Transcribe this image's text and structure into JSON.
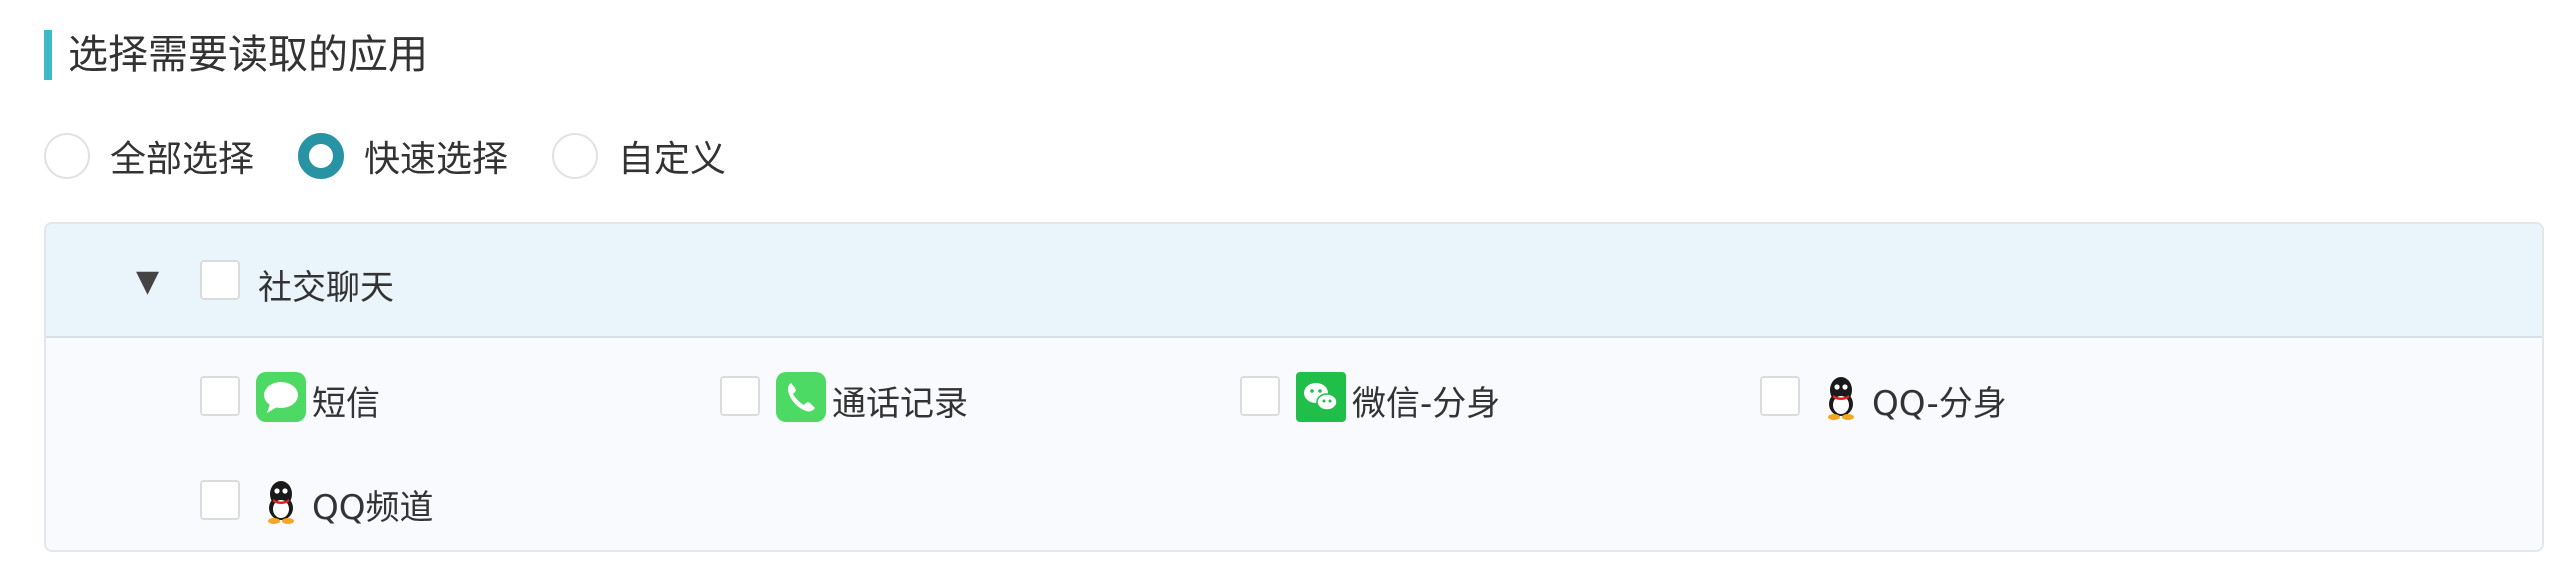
{
  "header": {
    "title": "选择需要读取的应用"
  },
  "mode": {
    "options": [
      "全部选择",
      "快速选择",
      "自定义"
    ],
    "selected": "快速选择"
  },
  "group": {
    "label": "社交聊天",
    "items": [
      {
        "label": "短信",
        "icon": "message-icon"
      },
      {
        "label": "通话记录",
        "icon": "phone-icon"
      },
      {
        "label": "微信-分身",
        "icon": "wechat-icon"
      },
      {
        "label": "QQ-分身",
        "icon": "qq-icon"
      },
      {
        "label": "QQ频道",
        "icon": "qq-icon"
      }
    ]
  },
  "colors": {
    "accent": "#2893a3",
    "title_bar": "#3fb8c8",
    "message_green": "#4cd964",
    "wechat_green": "#1fbf4a"
  }
}
